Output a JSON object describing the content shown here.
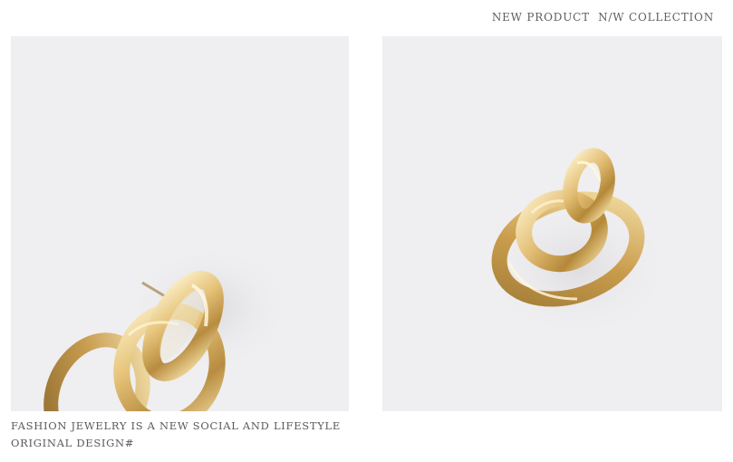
{
  "header": {
    "tag": "NEW PRODUCT  N/W COLLECTION"
  },
  "photos": [
    {
      "subject": "gold-knot-earring-closeup"
    },
    {
      "subject": "gold-knot-earring-front"
    }
  ],
  "caption": {
    "line1": "FASHION JEWELRY IS A NEW SOCIAL AND LIFESTYLE",
    "line2": "ORIGINAL DESIGN#"
  },
  "colors": {
    "background": "#efeef0",
    "gold_light": "#f6e3ad",
    "gold_mid": "#d9b56b",
    "gold_dark": "#9a7433",
    "text": "#5a5a5a"
  }
}
